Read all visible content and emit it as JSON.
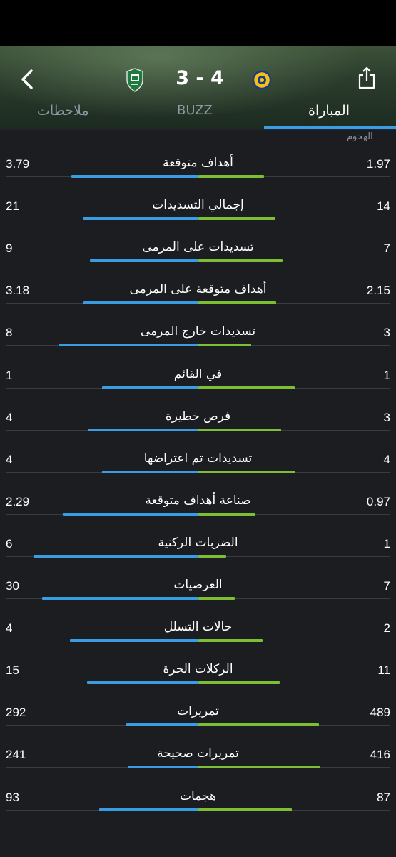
{
  "header": {
    "score": "3 - 4",
    "tabs": {
      "notes": "ملاحظات",
      "buzz": "BUZZ",
      "match": "المباراة"
    },
    "home_logo": "al-ahli-crest-icon",
    "away_logo": "al-nassr-crest-icon"
  },
  "section_title": "الهجوم",
  "colors": {
    "left_team": "#3a9de3",
    "right_team": "#7cbf35",
    "background": "#1c1d21"
  },
  "stats": [
    {
      "label": "أهداف متوقعة",
      "left": "3.79",
      "right": "1.97"
    },
    {
      "label": "إجمالي التسديدات",
      "left": "21",
      "right": "14"
    },
    {
      "label": "تسديدات على المرمى",
      "left": "9",
      "right": "7"
    },
    {
      "label": "أهداف متوقعة على المرمى",
      "left": "3.18",
      "right": "2.15"
    },
    {
      "label": "تسديدات خارج المرمى",
      "left": "8",
      "right": "3"
    },
    {
      "label": "في القائم",
      "left": "1",
      "right": "1"
    },
    {
      "label": "فرص خطيرة",
      "left": "4",
      "right": "3"
    },
    {
      "label": "تسديدات تم اعتراضها",
      "left": "4",
      "right": "4"
    },
    {
      "label": "صناعة أهداف متوقعة",
      "left": "2.29",
      "right": "0.97"
    },
    {
      "label": "الضربات الركنية",
      "left": "6",
      "right": "1"
    },
    {
      "label": "العرضيات",
      "left": "30",
      "right": "7"
    },
    {
      "label": "حالات التسلل",
      "left": "4",
      "right": "2"
    },
    {
      "label": "الركلات الحرة",
      "left": "15",
      "right": "11"
    },
    {
      "label": "تمريرات",
      "left": "292",
      "right": "489"
    },
    {
      "label": "تمريرات صحيحة",
      "left": "241",
      "right": "416"
    },
    {
      "label": "هجمات",
      "left": "93",
      "right": "87"
    }
  ]
}
